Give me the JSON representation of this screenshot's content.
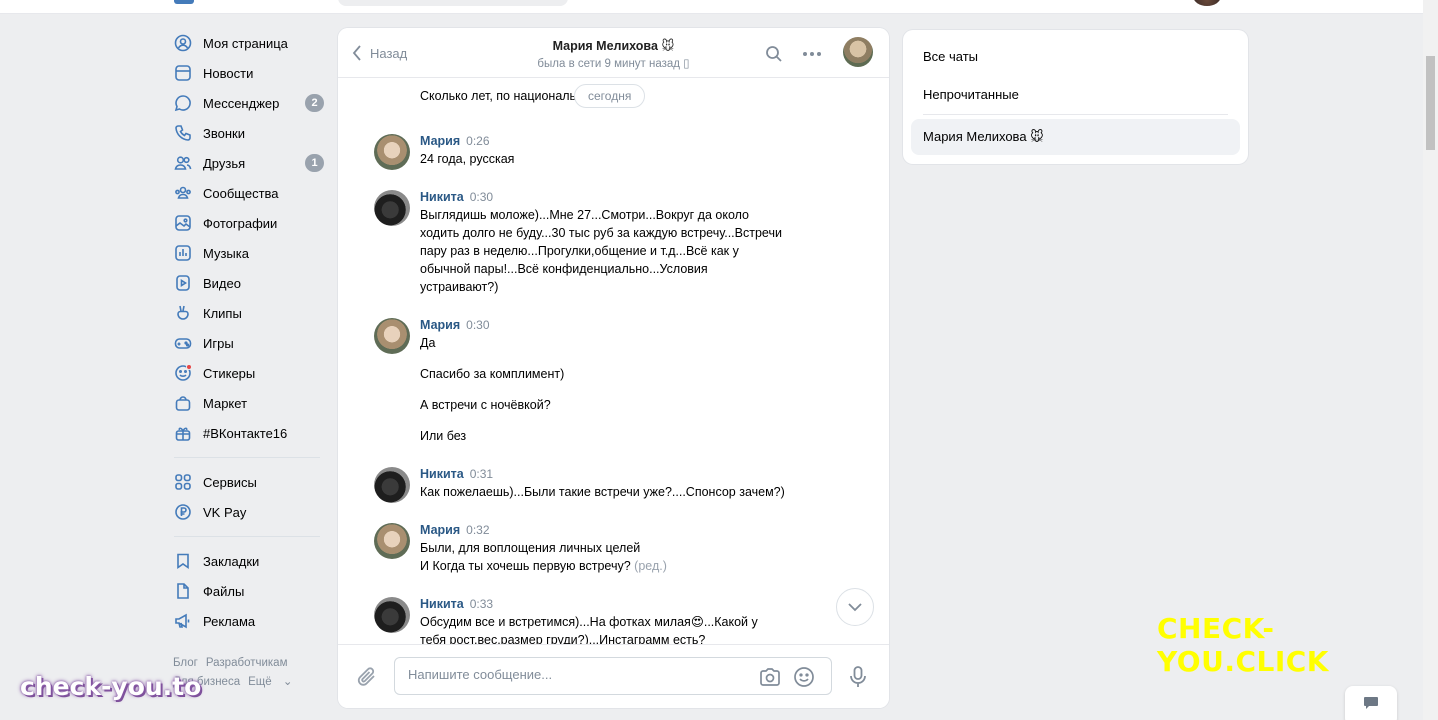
{
  "nav": {
    "items": [
      {
        "label": "Моя страница",
        "icon": "profile-icon"
      },
      {
        "label": "Новости",
        "icon": "news-icon"
      },
      {
        "label": "Мессенджер",
        "icon": "messenger-icon",
        "badge": "2"
      },
      {
        "label": "Звонки",
        "icon": "phone-icon"
      },
      {
        "label": "Друзья",
        "icon": "friends-icon",
        "badge": "1"
      },
      {
        "label": "Сообщества",
        "icon": "communities-icon"
      },
      {
        "label": "Фотографии",
        "icon": "photos-icon"
      },
      {
        "label": "Музыка",
        "icon": "music-icon"
      },
      {
        "label": "Видео",
        "icon": "video-icon"
      },
      {
        "label": "Клипы",
        "icon": "clips-icon"
      },
      {
        "label": "Игры",
        "icon": "games-icon"
      },
      {
        "label": "Стикеры",
        "icon": "stickers-icon"
      },
      {
        "label": "Маркет",
        "icon": "market-icon"
      },
      {
        "label": "#ВКонтакте16",
        "icon": "gift-icon"
      }
    ],
    "items2": [
      {
        "label": "Сервисы",
        "icon": "services-icon"
      },
      {
        "label": "VK Pay",
        "icon": "vkpay-icon"
      }
    ],
    "items3": [
      {
        "label": "Закладки",
        "icon": "bookmark-icon"
      },
      {
        "label": "Файлы",
        "icon": "file-icon"
      },
      {
        "label": "Реклама",
        "icon": "megaphone-icon"
      }
    ],
    "footer": {
      "blog": "Блог",
      "developers": "Разработчикам",
      "business": "Для бизнеса",
      "more": "Ещё"
    }
  },
  "chat": {
    "back_label": "Назад",
    "peer_name": "Мария Мелихова 🐭",
    "peer_status": "была в сети 9 минут назад",
    "date_label": "сегодня",
    "messages": [
      {
        "text0": "Сколько лет, по национальности?)"
      },
      {
        "author": "Мария",
        "time": "0:26",
        "lines": [
          "24 года, русская"
        ]
      },
      {
        "author": "Никита",
        "time": "0:30",
        "lines": [
          "Выглядишь моложе)...Мне 27...Смотри...Вокруг да около\nходить долго не буду...30 тыс руб за каждую встречу...Встречи\nпару раз в неделю...Прогулки,общение и т.д...Всё как у\nобычной пары!...Всё конфиденциально...Условия\nустраивают?)"
        ]
      },
      {
        "author": "Мария",
        "time": "0:30",
        "lines": [
          "Да",
          "Спасибо за комплимент)",
          "А встречи с ночёвкой?",
          "Или без"
        ]
      },
      {
        "author": "Никита",
        "time": "0:31",
        "lines": [
          "Как пожелаешь)...Были такие встречи уже?....Спонсор зачем?)"
        ]
      },
      {
        "author": "Мария",
        "time": "0:32",
        "lines": [
          "Были, для воплощения личных целей",
          "И Когда ты хочешь первую встречу?"
        ],
        "edited": "(ред.)"
      },
      {
        "author": "Никита",
        "time": "0:33",
        "lines": [
          "Обсудим все и встретимся)...На фотках милая😍...Какой у\nтебя рост,вес,размер груди?)...Инстаграмм есть?"
        ]
      }
    ],
    "composer_placeholder": "Напишите сообщение..."
  },
  "right_panel": {
    "all_chats": "Все чаты",
    "unread": "Непрочитанные",
    "active_chat": "Мария Мелихова 🐭"
  },
  "watermarks": {
    "yellow": "CHECK-YOU.CLICK",
    "left": "check-you.to"
  },
  "colors": {
    "link": "#2a5885",
    "muted": "#818c99",
    "badge": "#99a2ad",
    "background": "#edeef0"
  }
}
